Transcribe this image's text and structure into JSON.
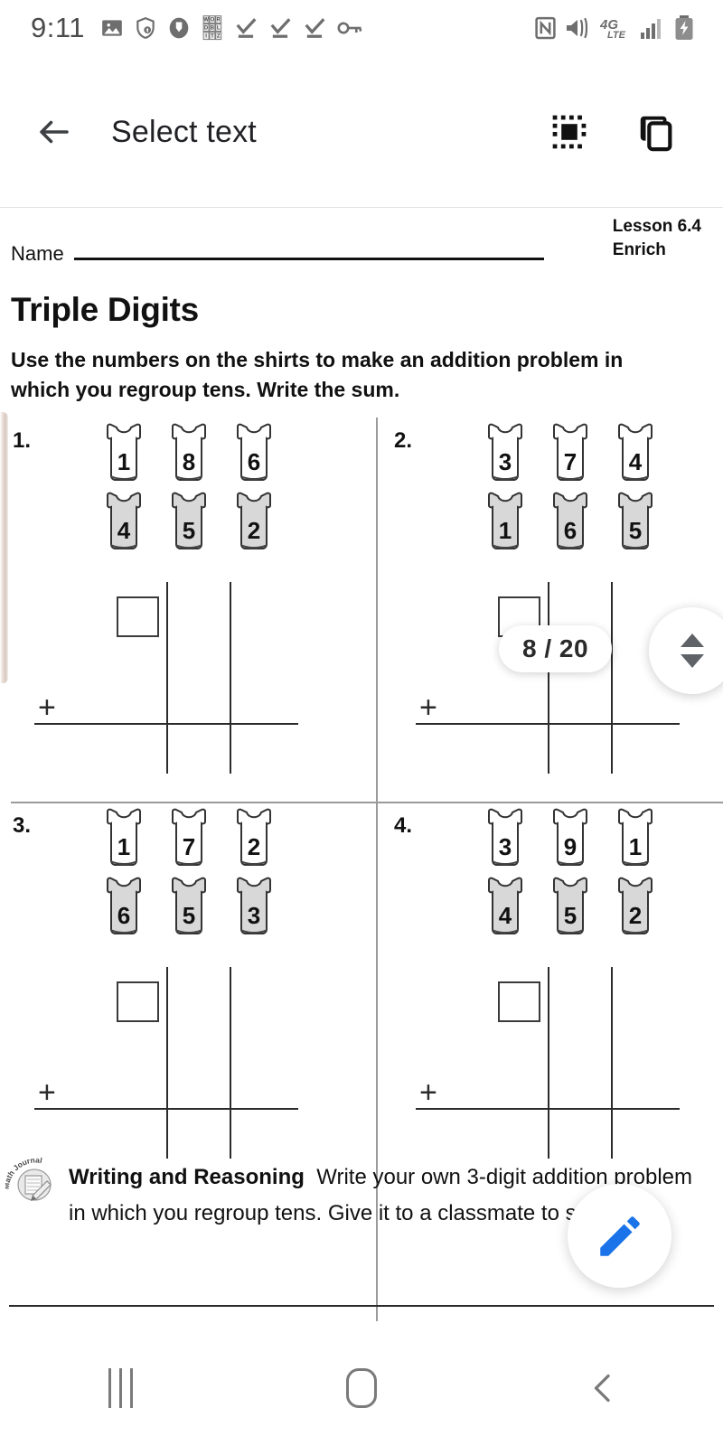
{
  "status_bar": {
    "time": "9:11",
    "left_icons": [
      "photo-icon",
      "shield-lock-icon",
      "pocket-icon",
      "wordblitz-icon",
      "check-download-icon",
      "check-download-icon",
      "check-download-icon",
      "vpn-key-icon"
    ],
    "right_icons": [
      "nfc-icon",
      "vibrate-icon",
      "network-4g-lte-icon",
      "signal-bars-icon",
      "battery-charging-icon"
    ],
    "network_label": "4G",
    "network_sub": "LTE",
    "wordblitz_letters": [
      "W",
      "O",
      "R",
      "D",
      "B",
      "L",
      "I",
      "T",
      "Z"
    ]
  },
  "app_bar": {
    "back_label": "back-arrow",
    "title": "Select text",
    "select_all_label": "select-all",
    "copy_label": "copy"
  },
  "document": {
    "lesson": "Lesson 6.4",
    "section": "Enrich",
    "name_label": "Name",
    "title": "Triple Digits",
    "instructions": "Use the numbers on the shirts to make an addition problem in which you regroup tens. Write the sum.",
    "problems": [
      {
        "number": "1.",
        "white_shirts": [
          "1",
          "8",
          "6"
        ],
        "gray_shirts": [
          "4",
          "5",
          "2"
        ],
        "operator": "+"
      },
      {
        "number": "2.",
        "white_shirts": [
          "3",
          "7",
          "4"
        ],
        "gray_shirts": [
          "1",
          "6",
          "5"
        ],
        "operator": "+"
      },
      {
        "number": "3.",
        "white_shirts": [
          "1",
          "7",
          "2"
        ],
        "gray_shirts": [
          "6",
          "5",
          "3"
        ],
        "operator": "+"
      },
      {
        "number": "4.",
        "white_shirts": [
          "3",
          "9",
          "1"
        ],
        "gray_shirts": [
          "4",
          "5",
          "2"
        ],
        "operator": "+"
      }
    ],
    "journal": {
      "icon_label": "Math Journal",
      "heading": "Writing and Reasoning",
      "body": "Write your own 3-digit addition problem in which you regroup tens. Give it to a classmate to solve."
    }
  },
  "overlay": {
    "page_indicator": "8 / 20",
    "scroll_up": "scroll-up",
    "scroll_down": "scroll-down",
    "fab_label": "edit-pencil"
  },
  "nav_bar": {
    "recents": "recents",
    "home": "home",
    "back": "back"
  }
}
